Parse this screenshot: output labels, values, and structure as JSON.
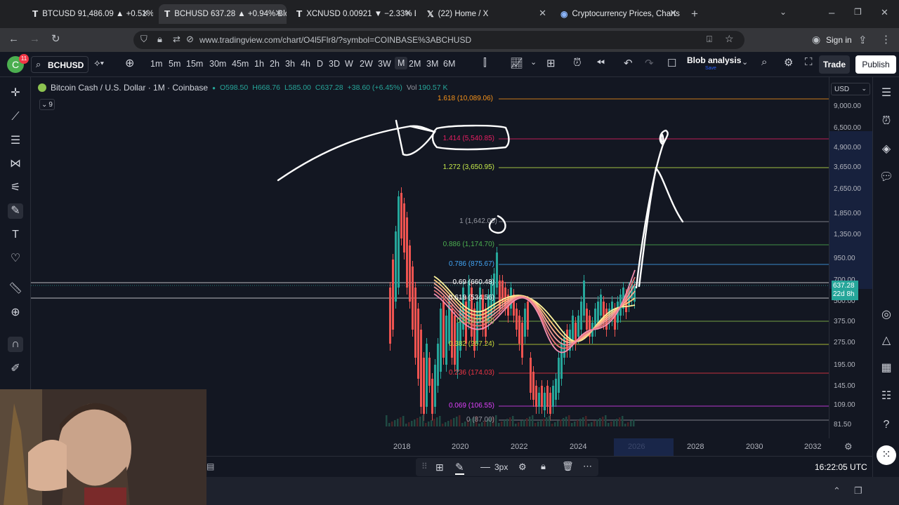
{
  "browser": {
    "tabs": [
      {
        "label": "BTCUSD 91,486.09 ▲ +0.51% Bl",
        "active": false
      },
      {
        "label": "BCHUSD 637.28 ▲ +0.94% Blob",
        "active": true
      },
      {
        "label": "XCNUSD 0.00921 ▼ −2.33% Blo",
        "active": false
      },
      {
        "label": "(22) Home / X",
        "active": false
      },
      {
        "label": "Cryptocurrency Prices, Charts A",
        "active": false
      }
    ],
    "url": "www.tradingview.com/chart/O4l5Flr8/?symbol=COINBASE%3ABCHUSD",
    "sign_in": "Sign in"
  },
  "toolbar": {
    "avatar": "C",
    "avatar_badge": "11",
    "symbol": "BCHUSD",
    "timeframes": [
      "1m",
      "5m",
      "15m",
      "30m",
      "45m",
      "1h",
      "2h",
      "3h",
      "4h",
      "D",
      "3D",
      "W",
      "2W",
      "3W",
      "M",
      "2M",
      "3M",
      "6M"
    ],
    "selected_timeframe": "M",
    "layout_name": "Blob analysis",
    "layout_sub": "Save",
    "trade": "Trade",
    "publish": "Publish"
  },
  "legend": {
    "title": "Bitcoin Cash / U.S. Dollar · 1M · Coinbase",
    "o": "O598.50",
    "h": "H668.76",
    "l": "L585.00",
    "c": "C637.28",
    "chg": "+38.60 (+6.45%)",
    "vol": "Vol",
    "vol_val": "190.57 K",
    "indicators_count": "9"
  },
  "fib_levels": [
    {
      "label": "1.618 (10,089.06)",
      "color": "#f7931a"
    },
    {
      "label": "1.414 (5,540.85)",
      "color": "#e91e63"
    },
    {
      "label": "1.272 (3,650.95)",
      "color": "#c6e94b"
    },
    {
      "label": "1 (1,642.05)",
      "color": "#9598a1"
    },
    {
      "label": "0.886 (1,174.70)",
      "color": "#4caf50"
    },
    {
      "label": "0.786 (875.67)",
      "color": "#42a5f5"
    },
    {
      "label": "0.69 (660.48)",
      "color": "#ffffff"
    },
    {
      "label": "0.618 (534.56)",
      "color": "#ffffff"
    },
    {
      "label": "0.5 (377.93)",
      "color": "#8bc34a"
    },
    {
      "label": "0.382 (267.24)",
      "color": "#cddc39"
    },
    {
      "label": "0.236 (174.03)",
      "color": "#f23645"
    },
    {
      "label": "0.069 (106.55)",
      "color": "#e040fb"
    },
    {
      "label": "0 (87.00)",
      "color": "#9598a1"
    }
  ],
  "price_axis": {
    "currency": "USD",
    "ticks": [
      "9,000.00",
      "6,500.00",
      "4,900.00",
      "3,650.00",
      "2,650.00",
      "1,850.00",
      "1,350.00",
      "950.00",
      "700.00",
      "500.00",
      "375.00",
      "275.00",
      "195.00",
      "145.00",
      "109.00",
      "81.50"
    ],
    "last_price": "637.28",
    "countdown": "22d 8h"
  },
  "time_axis": [
    "2018",
    "2020",
    "2022",
    "2024",
    "2026",
    "2028",
    "2030",
    "2032"
  ],
  "bottom": {
    "stroke_width": "3px",
    "clock": "16:22:05 UTC"
  },
  "colors": {
    "up": "#26a69a",
    "down": "#ef5350",
    "bg": "#131722",
    "accent": "#2962ff"
  }
}
